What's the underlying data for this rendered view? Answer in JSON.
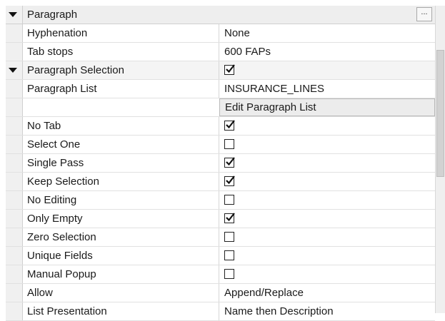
{
  "grid": {
    "sections": [
      {
        "label": "Paragraph",
        "expanded": true,
        "has_value_cell": false,
        "ellipsis": "...",
        "properties": [
          {
            "name": "Hyphenation",
            "type": "text",
            "value": "None"
          },
          {
            "name": "Tab stops",
            "type": "text",
            "value": "600 FAPs"
          }
        ]
      },
      {
        "label": "Paragraph Selection",
        "expanded": true,
        "has_value_cell": true,
        "value_type": "checkbox",
        "checked": true,
        "properties": [
          {
            "name": "Paragraph List",
            "type": "text",
            "value": "INSURANCE_LINES"
          },
          {
            "name": "",
            "type": "button",
            "value": "Edit Paragraph List"
          },
          {
            "name": "No Tab",
            "type": "checkbox",
            "checked": true
          },
          {
            "name": "Select One",
            "type": "checkbox",
            "checked": false
          },
          {
            "name": "Single Pass",
            "type": "checkbox",
            "checked": true
          },
          {
            "name": "Keep Selection",
            "type": "checkbox",
            "checked": true
          },
          {
            "name": "No Editing",
            "type": "checkbox",
            "checked": false
          },
          {
            "name": "Only Empty",
            "type": "checkbox",
            "checked": true
          },
          {
            "name": "Zero Selection",
            "type": "checkbox",
            "checked": false
          },
          {
            "name": "Unique Fields",
            "type": "checkbox",
            "checked": false
          },
          {
            "name": "Manual Popup",
            "type": "checkbox",
            "checked": false
          },
          {
            "name": "Allow",
            "type": "text",
            "value": "Append/Replace"
          },
          {
            "name": "List Presentation",
            "type": "text",
            "value": "Name then Description"
          }
        ]
      }
    ]
  },
  "icons": {
    "expand": "chevron-down-icon",
    "checkmark": "checkmark-icon"
  },
  "colors": {
    "gutter": "#f0f0f0",
    "header_bg": "#eeeeee",
    "row_line": "#e1e1e1"
  }
}
